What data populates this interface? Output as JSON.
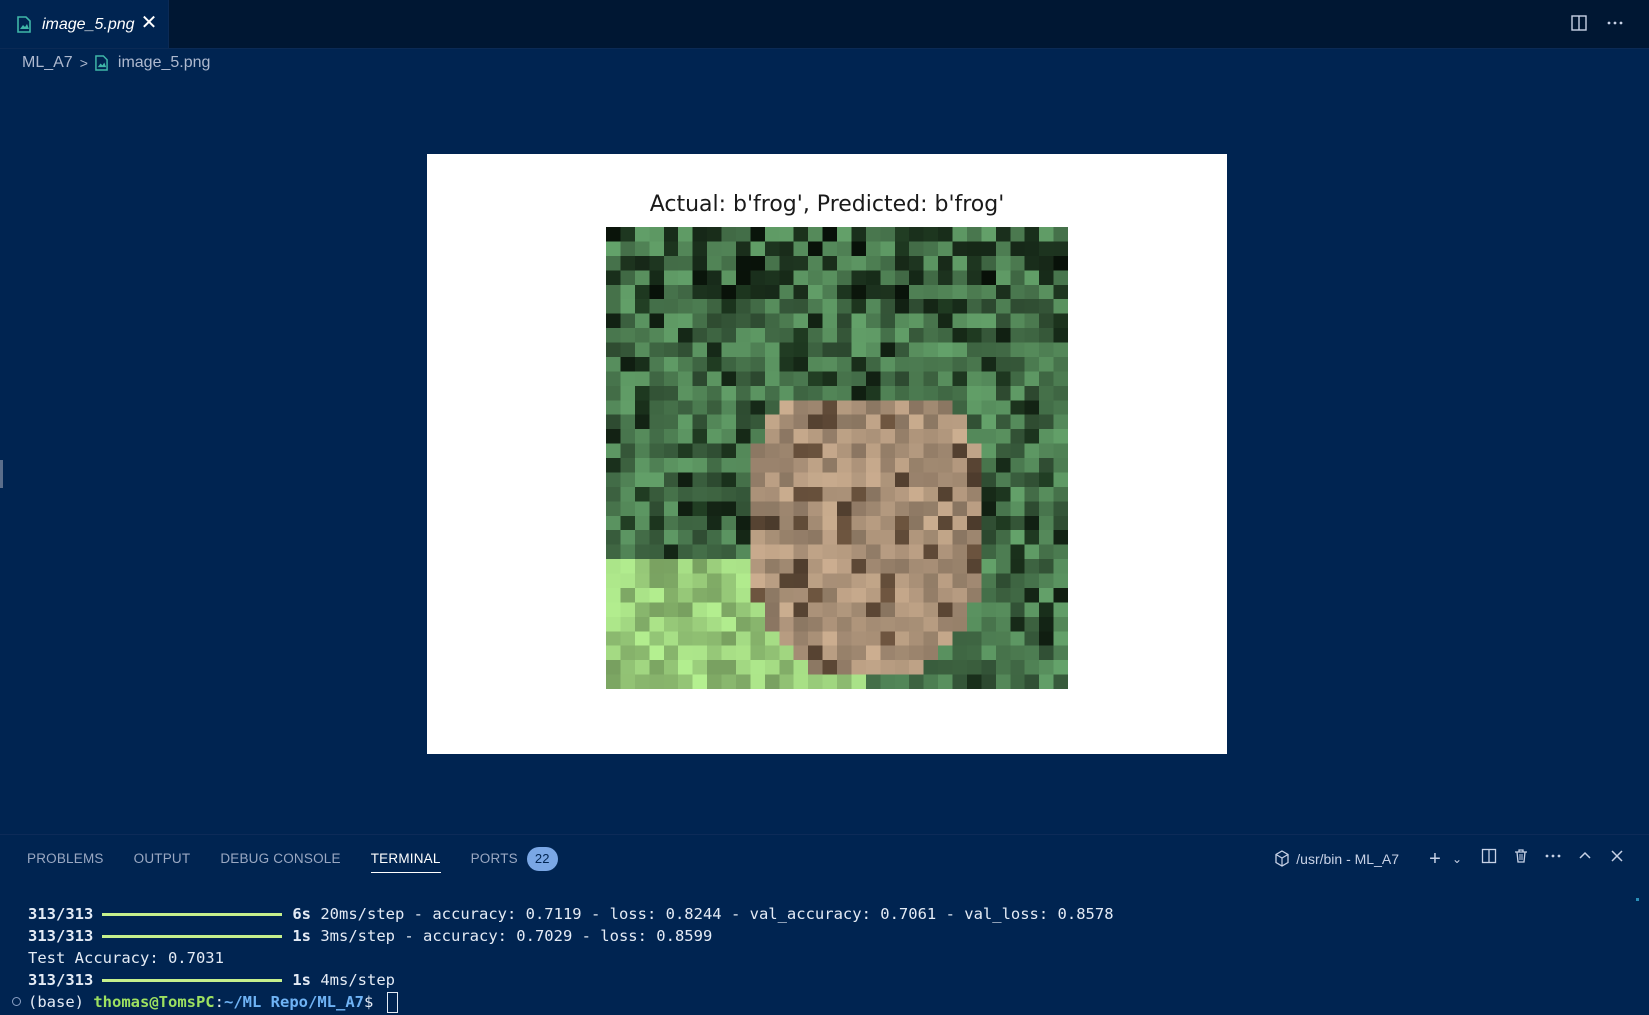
{
  "tab": {
    "label": "image_5.png",
    "close_glyph": "✕"
  },
  "tab_actions": [
    "split-editor-icon",
    "more-actions-icon"
  ],
  "breadcrumb": {
    "folder": "ML_A7",
    "file": "image_5.png"
  },
  "figure": {
    "title": "Actual: b'frog', Predicted: b'frog'",
    "image_content": "32x32 pixelated CIFAR-10 frog image"
  },
  "panel": {
    "tabs": [
      "PROBLEMS",
      "OUTPUT",
      "DEBUG CONSOLE",
      "TERMINAL",
      "PORTS"
    ],
    "active_tab": "TERMINAL",
    "ports_badge": "22",
    "shell_label": "/usr/bin - ML_A7"
  },
  "terminal": {
    "lines": [
      {
        "progress": "313/313",
        "time": "6s",
        "rest": "20ms/step - accuracy: 0.7119 - loss: 0.8244 - val_accuracy: 0.7061 - val_loss: 0.8578"
      },
      {
        "progress": "313/313",
        "time": "1s",
        "rest": "3ms/step - accuracy: 0.7029 - loss: 0.8599"
      },
      {
        "text": "Test Accuracy: 0.7031"
      },
      {
        "progress": "313/313",
        "time": "1s",
        "rest": "4ms/step"
      }
    ],
    "prompt": {
      "env": "(base) ",
      "user": "thomas@TomsPC",
      "sep": ":",
      "path": "~/ML Repo/ML_A7",
      "symbol": "$ "
    }
  },
  "colors": {
    "background": "#002451",
    "tabbar": "#001733",
    "accent_green": "#9de060",
    "path_blue": "#6fb3f5",
    "badge": "#7aa7e5"
  }
}
